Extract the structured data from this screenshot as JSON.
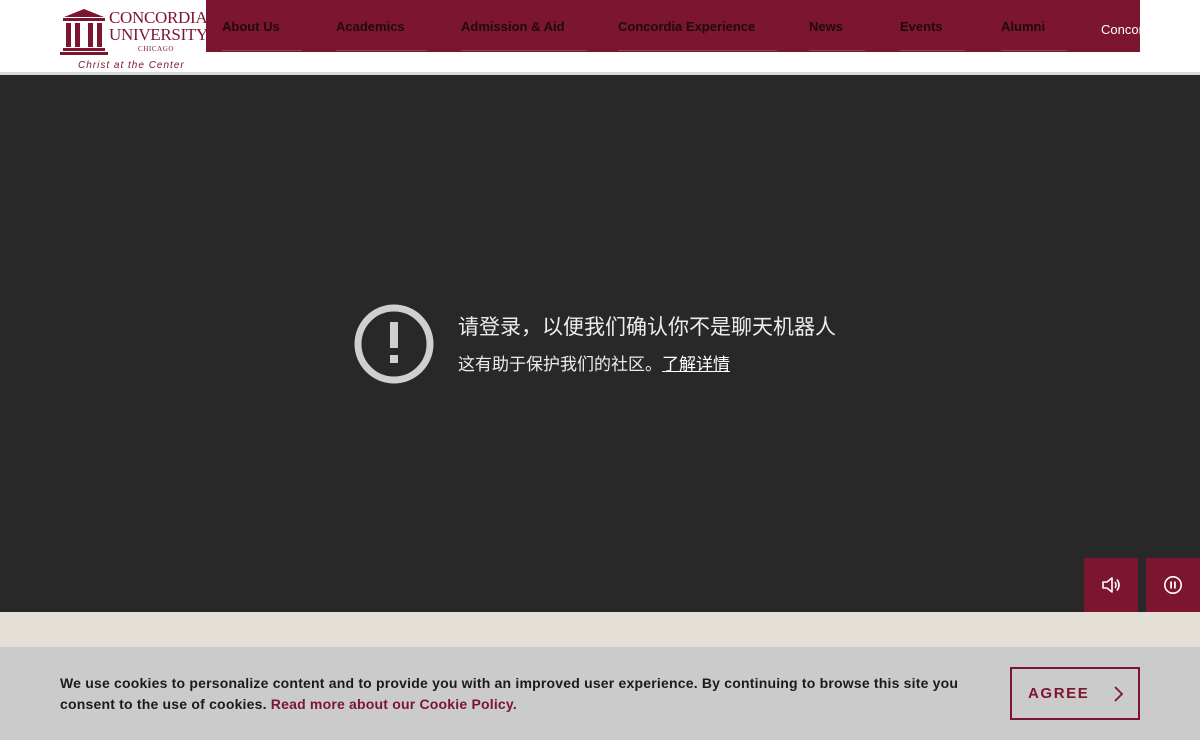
{
  "logo": {
    "line1": "CONCORDIA",
    "line2": "UNIVERSITY",
    "city": "CHICAGO",
    "tagline": "Christ at the Center",
    "icon": "columns-logo-icon"
  },
  "nav": {
    "items": [
      {
        "label": "About Us"
      },
      {
        "label": "Academics"
      },
      {
        "label": "Admission & Aid"
      },
      {
        "label": "Concordia Experience"
      },
      {
        "label": "News"
      },
      {
        "label": "Events"
      },
      {
        "label": "Alumni"
      }
    ],
    "extra": "Concordia Connect"
  },
  "hero": {
    "title": "请登录，以便我们确认你不是聊天机器人",
    "subtitle": "这有助于保护我们的社区。",
    "link": "了解详情",
    "icon": "exclamation-circle-icon"
  },
  "media_controls": {
    "volume_icon": "volume-icon",
    "pause_icon": "pause-icon"
  },
  "cookie": {
    "text": "We use cookies to personalize content and to provide you with an improved user experience. By continuing to browse this site you consent to the use of cookies.",
    "link": "Read more about our Cookie Policy.",
    "agree_label": "AGREE",
    "agree_icon": "chevron-right-icon"
  },
  "colors": {
    "brand": "#7b1530",
    "hero_bg": "#282828",
    "band": "#e4e0d8",
    "cookie_bg": "#cbcbcb"
  }
}
